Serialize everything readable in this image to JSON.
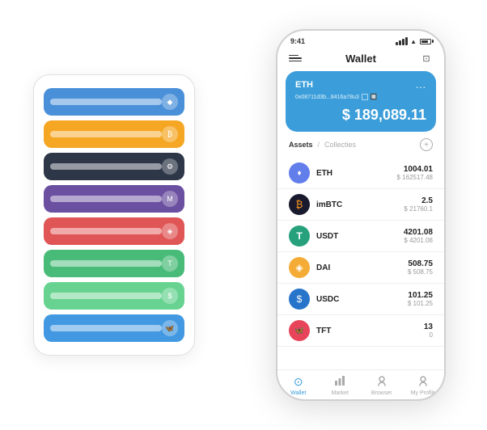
{
  "scene": {
    "background": "#ffffff"
  },
  "cardStack": {
    "cards": [
      {
        "color": "card-blue",
        "label": "Blue card"
      },
      {
        "color": "card-orange",
        "label": "Orange card"
      },
      {
        "color": "card-dark",
        "label": "Dark card"
      },
      {
        "color": "card-purple",
        "label": "Purple card"
      },
      {
        "color": "card-red",
        "label": "Red card"
      },
      {
        "color": "card-green",
        "label": "Green card"
      },
      {
        "color": "card-lightgreen",
        "label": "Light green card"
      },
      {
        "color": "card-blue2",
        "label": "Blue2 card"
      }
    ]
  },
  "phone": {
    "statusBar": {
      "time": "9:41"
    },
    "header": {
      "title": "Wallet"
    },
    "ethCard": {
      "title": "ETH",
      "address": "0x08711d3b...8416a78u3",
      "balance": "$ 189,089.11",
      "moreLabel": "..."
    },
    "assets": {
      "tab_active": "Assets",
      "tab_separator": "/",
      "tab_inactive": "Collecties",
      "add_label": "+"
    },
    "assetList": [
      {
        "name": "ETH",
        "amount": "1004.01",
        "usd": "$ 162517.48",
        "icon": "♦",
        "iconClass": "eth-icon"
      },
      {
        "name": "imBTC",
        "amount": "2.5",
        "usd": "$ 21760.1",
        "icon": "₿",
        "iconClass": "imbtc-icon"
      },
      {
        "name": "USDT",
        "amount": "4201.08",
        "usd": "$ 4201.08",
        "icon": "T",
        "iconClass": "usdt-icon"
      },
      {
        "name": "DAI",
        "amount": "508.75",
        "usd": "$ 508.75",
        "icon": "◈",
        "iconClass": "dai-icon"
      },
      {
        "name": "USDC",
        "amount": "101.25",
        "usd": "$ 101.25",
        "icon": "$",
        "iconClass": "usdc-icon"
      },
      {
        "name": "TFT",
        "amount": "13",
        "usd": "0",
        "icon": "🦋",
        "iconClass": "tft-icon"
      }
    ],
    "bottomNav": [
      {
        "label": "Wallet",
        "icon": "⊙",
        "active": true
      },
      {
        "label": "Market",
        "icon": "📊",
        "active": false
      },
      {
        "label": "Browser",
        "icon": "👤",
        "active": false
      },
      {
        "label": "My Profile",
        "icon": "👤",
        "active": false
      }
    ]
  }
}
